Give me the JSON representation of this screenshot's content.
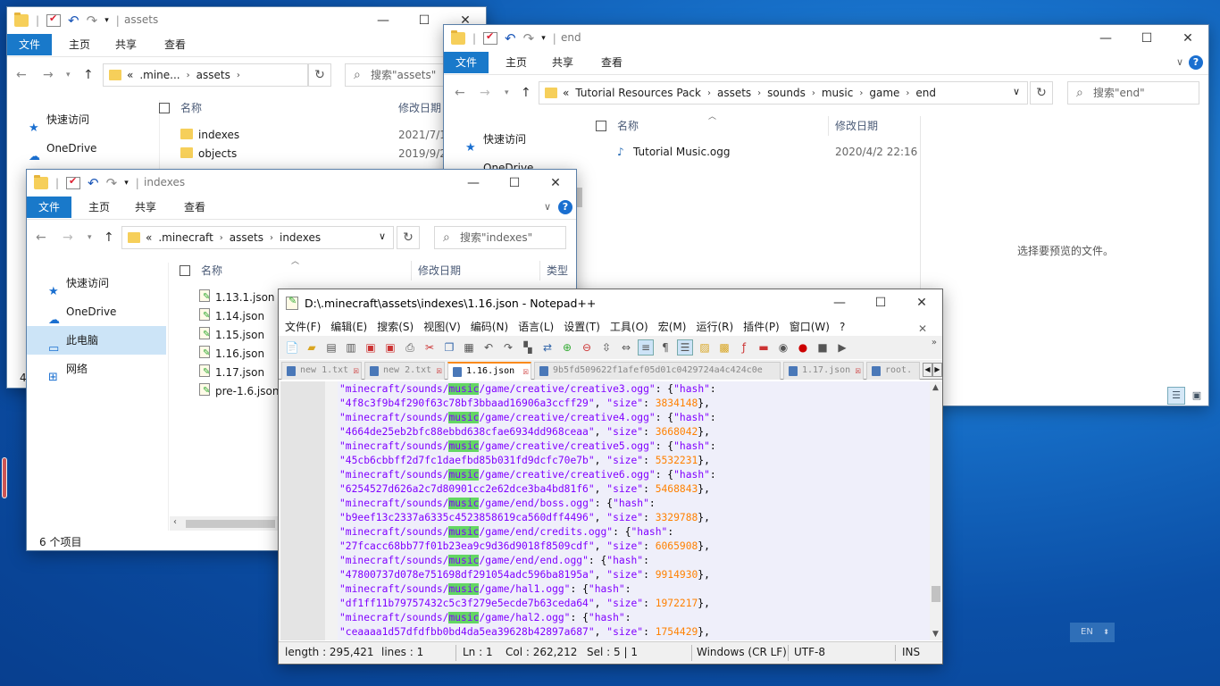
{
  "win_end": {
    "title": "end",
    "tabs": [
      "文件",
      "主页",
      "共享",
      "查看"
    ],
    "address": [
      "Tutorial Resources Pack",
      "assets",
      "sounds",
      "music",
      "game",
      "end"
    ],
    "search_placeholder": "搜索\"end\"",
    "nav": [
      "快速访问",
      "OneDrive"
    ],
    "col_name": "名称",
    "col_date": "修改日期",
    "file_name": "Tutorial Music.ogg",
    "file_date": "2020/4/2 22:16",
    "preview_text": "选择要预览的文件。"
  },
  "win_assets": {
    "title": "assets",
    "tabs": [
      "文件",
      "主页",
      "共享",
      "查看"
    ],
    "address": [
      ".mine...",
      "assets"
    ],
    "search_placeholder": "搜索\"assets\"",
    "nav": [
      "快速访问",
      "OneDrive"
    ],
    "col_name": "名称",
    "col_date": "修改日期",
    "rows": [
      {
        "name": "indexes",
        "date": "2021/7/1"
      },
      {
        "name": "objects",
        "date": "2019/9/2"
      }
    ],
    "status_count": "4"
  },
  "win_indexes": {
    "title": "indexes",
    "tabs": [
      "文件",
      "主页",
      "共享",
      "查看"
    ],
    "address": [
      ".minecraft",
      "assets",
      "indexes"
    ],
    "search_placeholder": "搜索\"indexes\"",
    "nav": [
      "快速访问",
      "OneDrive",
      "此电脑",
      "网络"
    ],
    "col_name": "名称",
    "col_date": "修改日期",
    "col_type": "类型",
    "rows": [
      "1.13.1.json",
      "1.14.json",
      "1.15.json",
      "1.16.json",
      "1.17.json",
      "pre-1.6.json"
    ],
    "status": "6 个项目"
  },
  "npp": {
    "title": "D:\\.minecraft\\assets\\indexes\\1.16.json - Notepad++",
    "menu": [
      "文件(F)",
      "编辑(E)",
      "搜索(S)",
      "视图(V)",
      "编码(N)",
      "语言(L)",
      "设置(T)",
      "工具(O)",
      "宏(M)",
      "运行(R)",
      "插件(P)",
      "窗口(W)",
      "?"
    ],
    "tabs": [
      "new 1.txt",
      "new 2.txt",
      "1.16.json",
      "9b5fd509622f1afef05d01c0429724a4c424c0e",
      "1.17.json",
      "root."
    ],
    "lines": [
      {
        "path": "\"minecraft/sounds/",
        "hl": "music",
        "rest": "/game/creative/creative3.ogg\"",
        "tail": ": {\"hash\":"
      },
      {
        "hash": "\"4f8c3f9b4f290f63c78bf3bbaad16906a3ccff29\"",
        "size": "3834148"
      },
      {
        "path": "\"minecraft/sounds/",
        "hl": "music",
        "rest": "/game/creative/creative4.ogg\"",
        "tail": ": {\"hash\":"
      },
      {
        "hash": "\"4664de25eb2bfc88ebbd638cfae6934dd968ceaa\"",
        "size": "3668042"
      },
      {
        "path": "\"minecraft/sounds/",
        "hl": "music",
        "rest": "/game/creative/creative5.ogg\"",
        "tail": ": {\"hash\":"
      },
      {
        "hash": "\"45cb6cbbff2d7fc1daefbd85b031fd9dcfc70e7b\"",
        "size": "5532231"
      },
      {
        "path": "\"minecraft/sounds/",
        "hl": "music",
        "rest": "/game/creative/creative6.ogg\"",
        "tail": ": {\"hash\":"
      },
      {
        "hash": "\"6254527d626a2c7d80901cc2e62dce3ba4bd81f6\"",
        "size": "5468843"
      },
      {
        "path": "\"minecraft/sounds/",
        "hl": "music",
        "rest": "/game/end/boss.ogg\"",
        "tail": ": {\"hash\":"
      },
      {
        "hash": "\"b9eef13c2337a6335c4523858619ca560dff4496\"",
        "size": "3329788"
      },
      {
        "path": "\"minecraft/sounds/",
        "hl": "music",
        "rest": "/game/end/credits.ogg\"",
        "tail": ": {\"hash\":"
      },
      {
        "hash": "\"27fcacc68bb77f01b23ea9c9d36d9018f8509cdf\"",
        "size": "6065908"
      },
      {
        "path": "\"minecraft/sounds/",
        "hl": "music",
        "rest": "/game/end/end.ogg\"",
        "tail": ": {\"hash\":"
      },
      {
        "hash": "\"47800737d078e751698df291054adc596ba8195a\"",
        "size": "9914930"
      },
      {
        "path": "\"minecraft/sounds/",
        "hl": "music",
        "rest": "/game/hal1.ogg\"",
        "tail": ": {\"hash\":"
      },
      {
        "hash": "\"df1ff11b79757432c5c3f279e5ecde7b63ceda64\"",
        "size": "1972217"
      },
      {
        "path": "\"minecraft/sounds/",
        "hl": "music",
        "rest": "/game/hal2.ogg\"",
        "tail": ": {\"hash\":"
      },
      {
        "hash": "\"ceaaaa1d57dfdfbb0bd4da5ea39628b42897a687\"",
        "size": "1754429"
      }
    ],
    "status": {
      "length": "length : 295,421",
      "lines": "lines : 1",
      "ln": "Ln : 1",
      "col": "Col : 262,212",
      "sel": "Sel : 5 | 1",
      "eol": "Windows (CR LF)",
      "enc": "UTF-8",
      "ins": "INS"
    }
  },
  "tray": {
    "lang": "EN"
  },
  "colors": {
    "accent": "#1979ca",
    "string": "#8000ff",
    "number": "#ff8000",
    "highlight": "#63d763"
  }
}
